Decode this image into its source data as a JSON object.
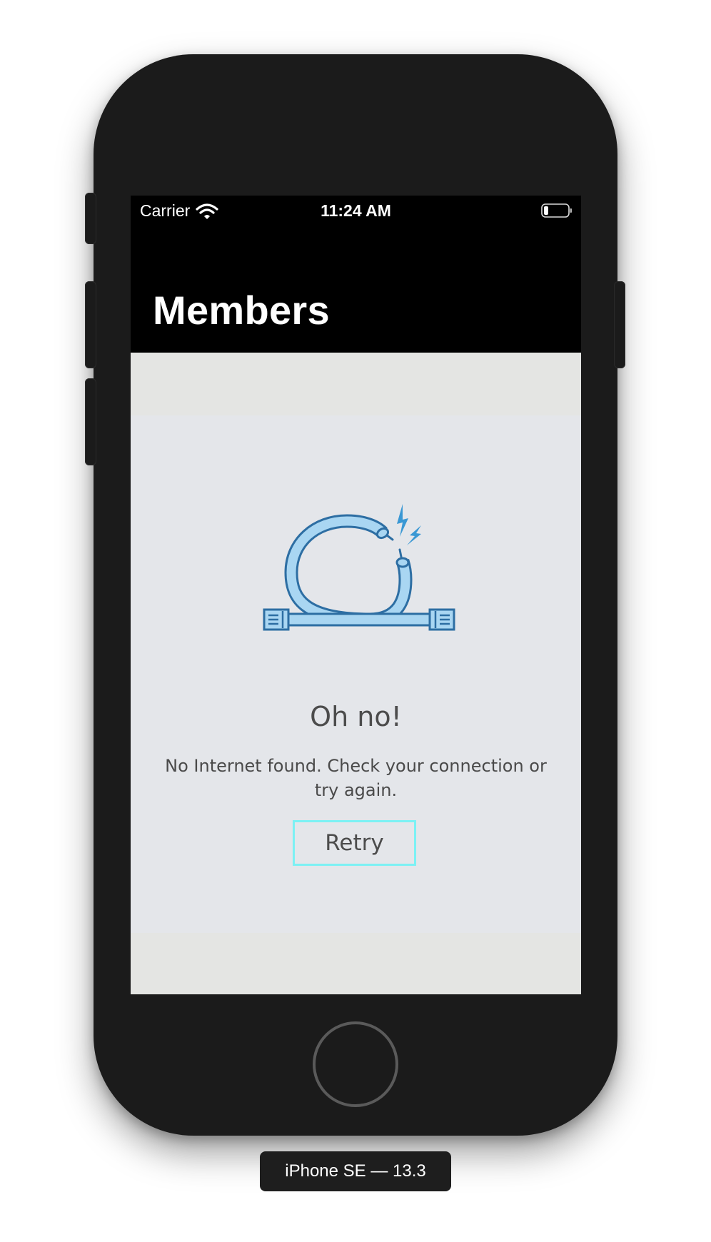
{
  "status_bar": {
    "carrier": "Carrier",
    "time": "11:24 AM",
    "wifi_icon": "wifi-icon",
    "battery_icon": "battery-low-icon"
  },
  "nav": {
    "title": "Members"
  },
  "error_state": {
    "illustration": "disconnected-cable-icon",
    "title": "Oh no!",
    "message": "No Internet found. Check your connection or try again.",
    "retry_label": "Retry"
  },
  "device": {
    "label": "iPhone SE — 13.3",
    "home_button": "home-button"
  },
  "colors": {
    "screen_background": "#e4e6ea",
    "nav_background": "#000000",
    "retry_border": "#7cf1f4",
    "icon_stroke": "#2d6ea3",
    "icon_fill": "#a9d6f2",
    "text": "#4c4c4c"
  }
}
